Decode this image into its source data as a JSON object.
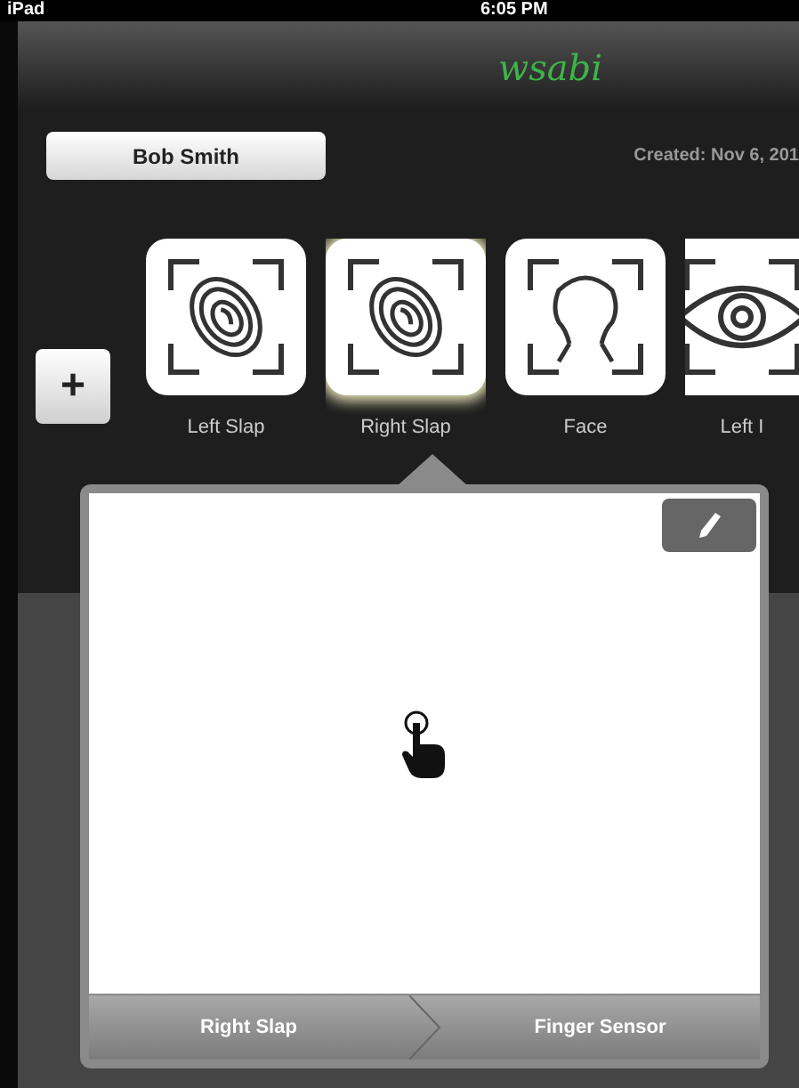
{
  "status_bar": {
    "device": "iPad",
    "time": "6:05 PM"
  },
  "app_title": "wsabi",
  "subject": {
    "name": "Bob Smith",
    "created": "Created: Nov 6, 201"
  },
  "add_button": "+",
  "captures": [
    {
      "kind": "fingerprint",
      "label": "Left Slap",
      "selected": false
    },
    {
      "kind": "fingerprint",
      "label": "Right Slap",
      "selected": true
    },
    {
      "kind": "face",
      "label": "Face",
      "selected": false
    },
    {
      "kind": "eye",
      "label": "Left I",
      "selected": false
    }
  ],
  "breadcrumb": [
    "Right Slap",
    "Finger Sensor"
  ]
}
